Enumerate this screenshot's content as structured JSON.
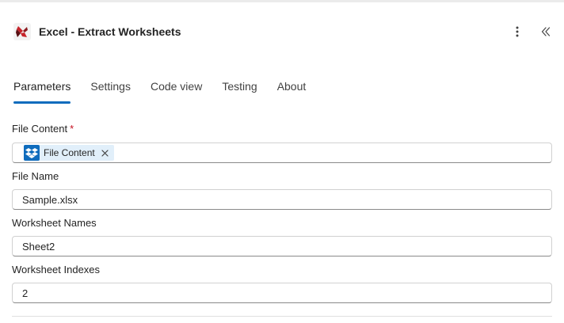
{
  "header": {
    "title": "Excel - Extract Worksheets"
  },
  "tabs": [
    {
      "label": "Parameters",
      "active": true
    },
    {
      "label": "Settings",
      "active": false
    },
    {
      "label": "Code view",
      "active": false
    },
    {
      "label": "Testing",
      "active": false
    },
    {
      "label": "About",
      "active": false
    }
  ],
  "fields": {
    "file_content": {
      "label": "File Content",
      "required_mark": "*",
      "token_label": "File Content"
    },
    "file_name": {
      "label": "File Name",
      "value": "Sample.xlsx"
    },
    "worksheet_names": {
      "label": "Worksheet Names",
      "value": "Sheet2"
    },
    "worksheet_indexes": {
      "label": "Worksheet Indexes",
      "value": "2"
    }
  },
  "colors": {
    "accent": "#0f6cbd",
    "required": "#c50f1f",
    "token_bg": "#e1effa"
  },
  "icons": {
    "app": "excel-connector-icon",
    "more": "more-vertical-icon",
    "collapse": "double-chevron-left-icon",
    "token": "dropbox-icon",
    "token_remove": "close-icon"
  }
}
